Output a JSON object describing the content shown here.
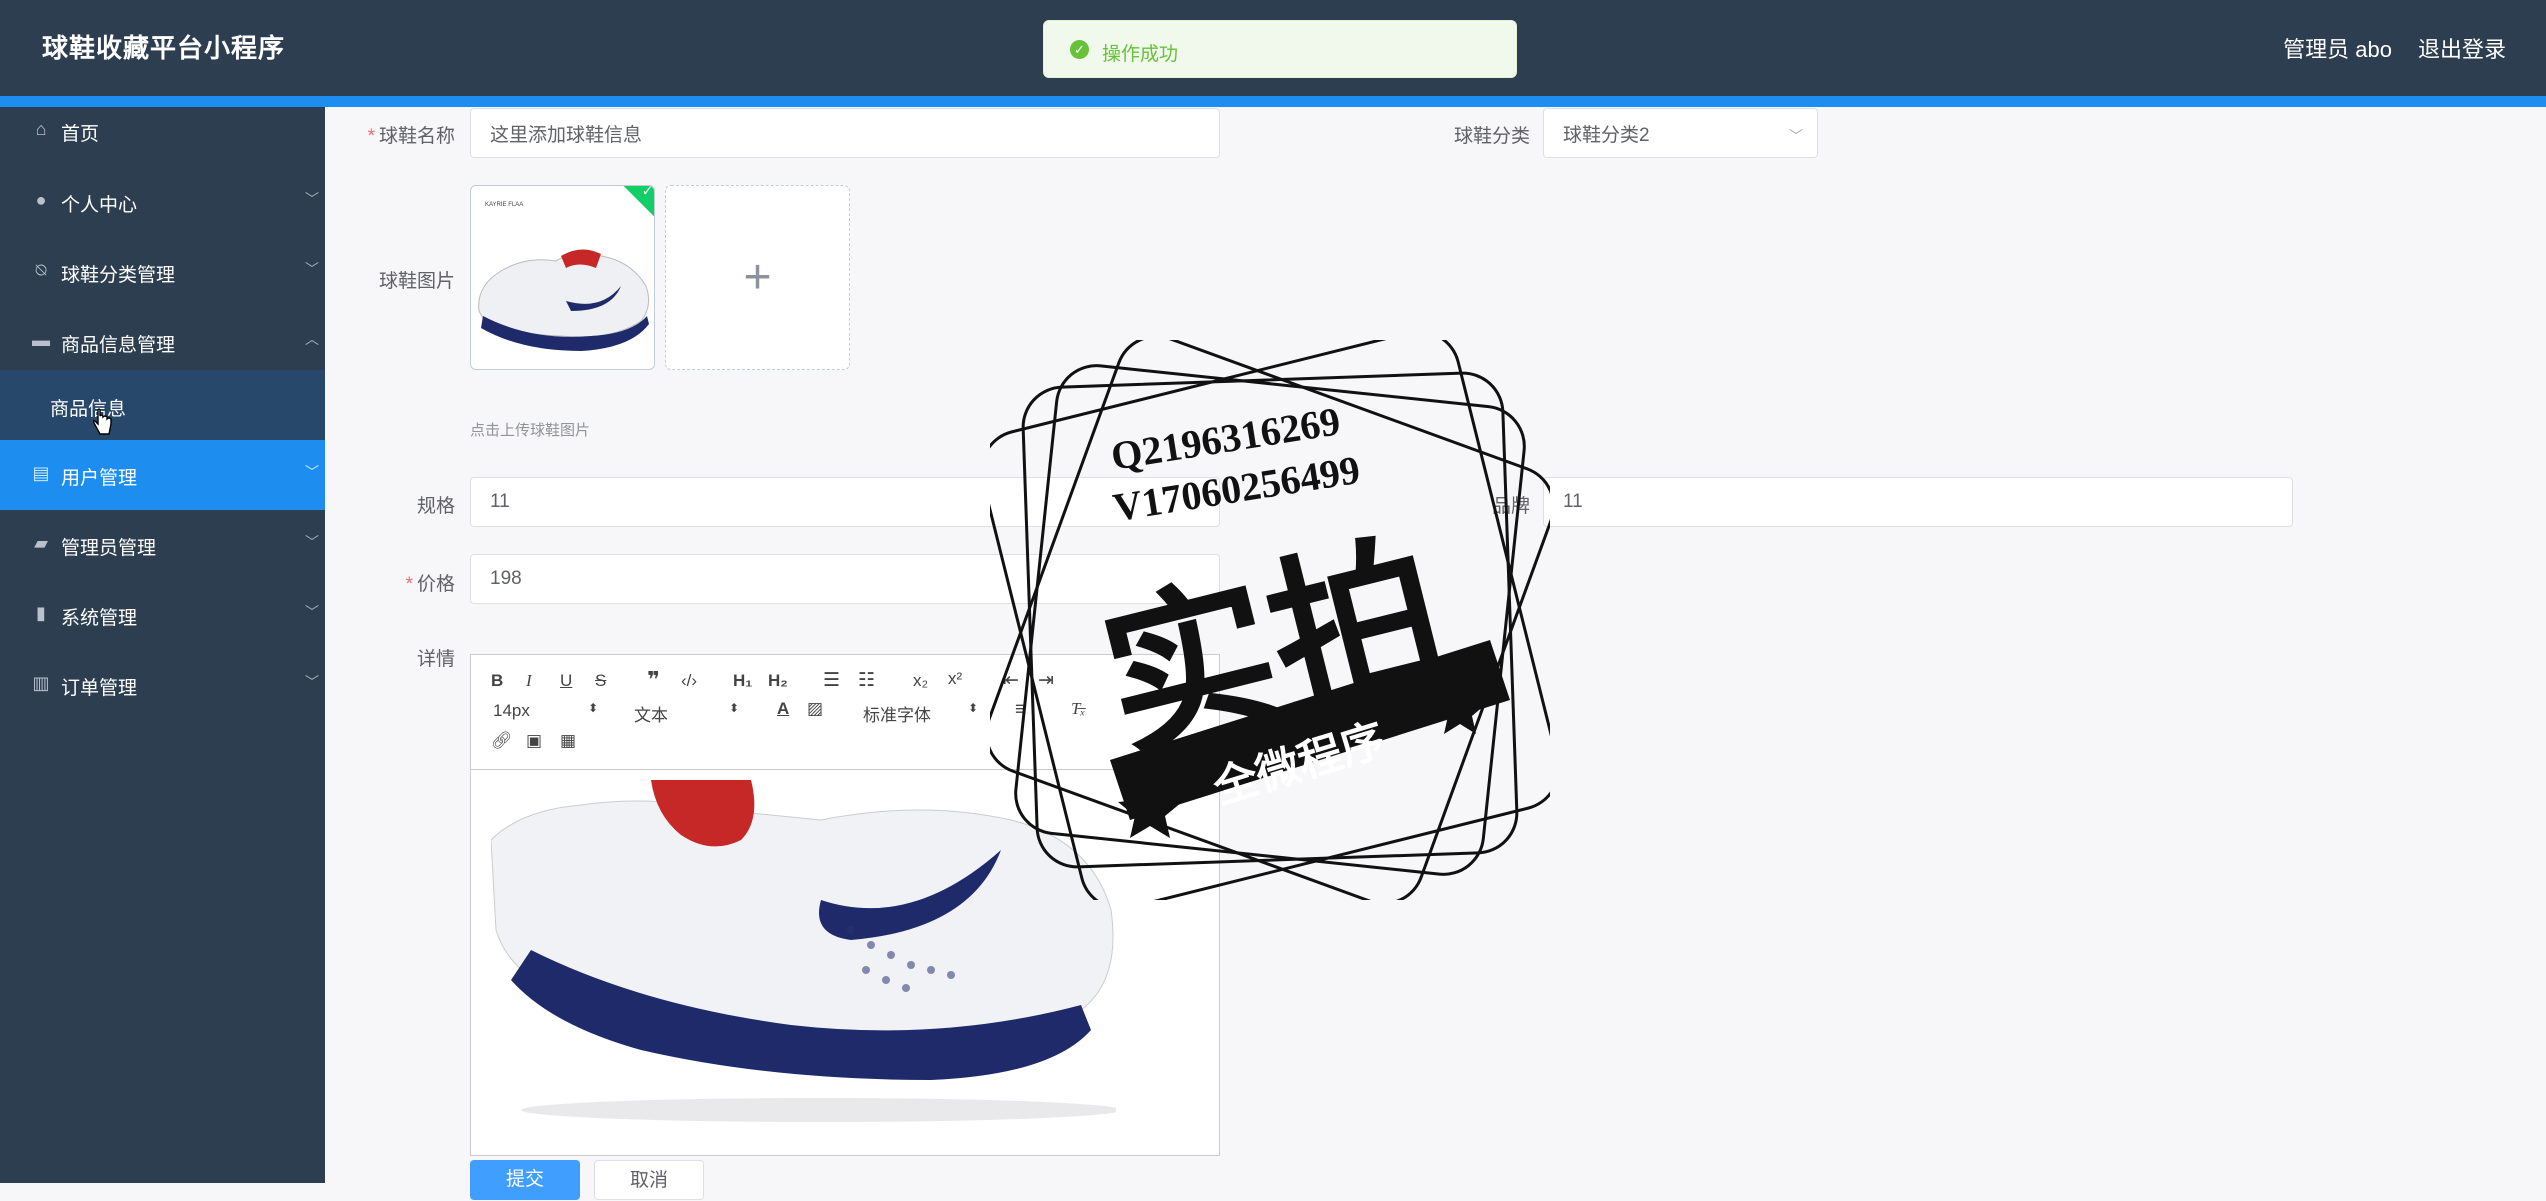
{
  "header": {
    "app_title": "球鞋收藏平台小程序",
    "admin_label": "管理员 abo",
    "logout_label": "退出登录"
  },
  "toast": {
    "message": "操作成功"
  },
  "sidebar": {
    "items": [
      {
        "label": "首页",
        "icon": "home-icon"
      },
      {
        "label": "个人中心",
        "icon": "user-icon"
      },
      {
        "label": "球鞋分类管理",
        "icon": "bell-off-icon"
      },
      {
        "label": "商品信息管理",
        "icon": "monitor-icon",
        "expanded": true
      },
      {
        "label": "商品信息",
        "icon": "",
        "submenu": true
      },
      {
        "label": "用户管理",
        "icon": "clipboard-icon",
        "active": true
      },
      {
        "label": "管理员管理",
        "icon": "briefcase-icon"
      },
      {
        "label": "系统管理",
        "icon": "bar-chart-icon"
      },
      {
        "label": "订单管理",
        "icon": "building-icon"
      }
    ]
  },
  "form": {
    "name_label": "球鞋名称",
    "name_value": "这里添加球鞋信息",
    "category_label": "球鞋分类",
    "category_value": "球鞋分类2",
    "image_label": "球鞋图片",
    "upload_hint": "点击上传球鞋图片",
    "spec_label": "规格",
    "spec_value": "11",
    "brand_label": "品牌",
    "brand_value": "11",
    "price_label": "价格",
    "price_value": "198",
    "detail_label": "详情",
    "submit_label": "提交",
    "cancel_label": "取消"
  },
  "editor": {
    "font_size": "14px",
    "block_type": "文本",
    "font_family": "标准字体"
  },
  "thumbnail": {
    "caption": "KAYRIE FLAA"
  },
  "watermark": {
    "line1": "Q2196316269",
    "line2": "V17060256499",
    "big": "实拍",
    "ribbon": "全微程序"
  },
  "colors": {
    "header_bg": "#2d3e50",
    "accent": "#1d8ef0",
    "success": "#67c23a"
  }
}
